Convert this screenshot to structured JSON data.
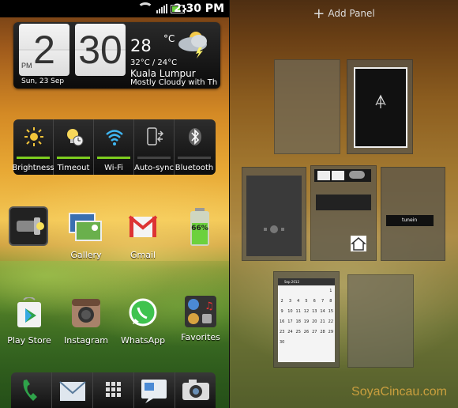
{
  "statusbar": {
    "time": "2:30 PM"
  },
  "clock_widget": {
    "hour": "2",
    "minute": "30",
    "ampm": "PM",
    "date": "Sun, 23 Sep",
    "temperature": "28",
    "degree_symbol": "°C",
    "hi_lo": "32°C / 24°C",
    "city": "Kuala Lumpur",
    "condition": "Mostly Cloudy with Thu"
  },
  "toggles": [
    {
      "label": "Brightness",
      "icon": "sun-icon",
      "on": true
    },
    {
      "label": "Timeout",
      "icon": "bulb-clock-icon",
      "on": true
    },
    {
      "label": "Wi-Fi",
      "icon": "wifi-icon",
      "on": true
    },
    {
      "label": "Auto-sync",
      "icon": "phone-sync-icon",
      "on": false
    },
    {
      "label": "Bluetooth",
      "icon": "bluetooth-icon",
      "on": false
    }
  ],
  "apps_row1": [
    {
      "label": "",
      "icon": "flashlight-icon"
    },
    {
      "label": "Gallery",
      "icon": "gallery-icon"
    },
    {
      "label": "Gmail",
      "icon": "gmail-icon"
    },
    {
      "label": "",
      "icon": "battery-icon",
      "value": "66%"
    }
  ],
  "apps_row2": [
    {
      "label": "Play Store",
      "icon": "play-store-icon"
    },
    {
      "label": "Instagram",
      "icon": "instagram-icon"
    },
    {
      "label": "WhatsApp",
      "icon": "whatsapp-icon"
    },
    {
      "label": "Favorites",
      "icon": "favorites-folder-icon"
    }
  ],
  "dock": [
    "phone-icon",
    "mail-icon",
    "all-apps-icon",
    "messages-icon",
    "camera-icon"
  ],
  "right_panel": {
    "add_panel_label": "Add Panel",
    "watermark": "SoyaCincau.com",
    "tunein_label": "tunein",
    "calendar_header": "Sep 2012"
  },
  "colors": {
    "accent_green": "#7dcc1f",
    "watermark": "#d7a640"
  }
}
